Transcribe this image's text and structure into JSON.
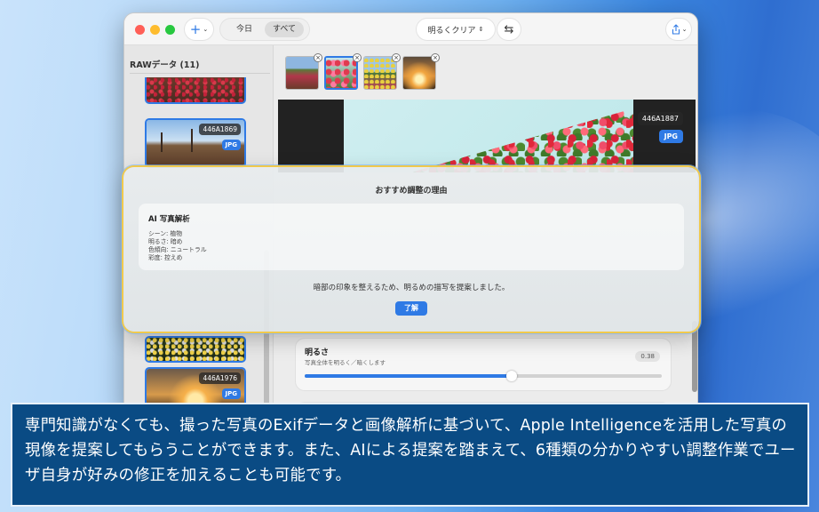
{
  "toolbar": {
    "add_label": "+",
    "segment": [
      "今日",
      "すべて"
    ],
    "preset_label": "明るくクリア",
    "swap_icon": "arrows-swap-icon",
    "share_icon": "share-icon"
  },
  "sidebar": {
    "title": "RAWデータ (11)",
    "items": [
      {
        "id": "",
        "type": ""
      },
      {
        "id": "446A1869",
        "type": "JPG"
      },
      {
        "id": "",
        "type": ""
      },
      {
        "id": "446A1976",
        "type": "JPG"
      }
    ]
  },
  "preview": {
    "id": "446A1887",
    "type": "JPG"
  },
  "brightness": {
    "label": "明るさ",
    "description": "写真全体を明るく／暗くします",
    "value": "0.38",
    "slider_fraction": 0.58
  },
  "modal": {
    "title": "おすすめ調整の理由",
    "analysis_title": "AI 写真解析",
    "analysis_lines": [
      "シーン: 植物",
      "明るさ: 暗め",
      "色傾向: ニュートラル",
      "彩度: 控えめ"
    ],
    "message": "暗部の印象を整えるため、明るめの描写を提案しました。",
    "ok_label": "了解"
  },
  "caption": "専門知識がなくても、撮った写真のExifデータと画像解析に基づいて、Apple Intelligenceを活用した写真の現像を提案してもらうことができます。また、AIによる提案を踏まえて、6種類の分かりやすい調整作業でユーザ自身が好みの修正を加えることも可能です。",
  "colors": {
    "accent": "#2f7ae5",
    "caption_bg": "#0a4b84"
  }
}
